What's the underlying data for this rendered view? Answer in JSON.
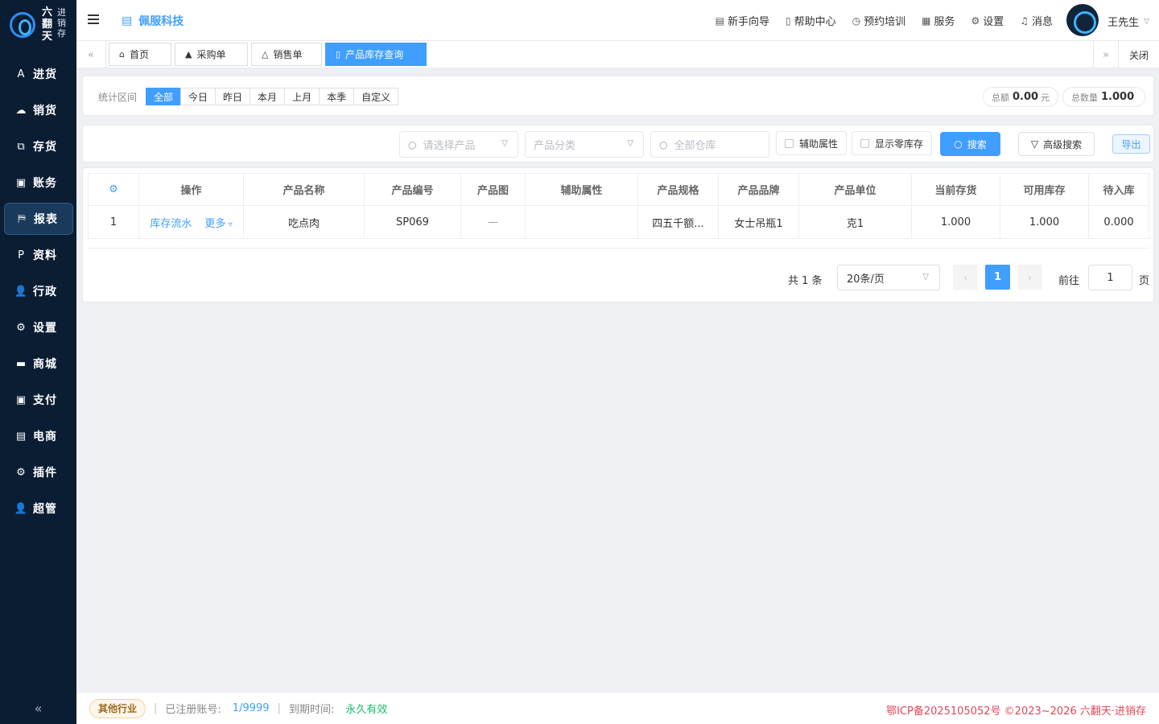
{
  "brand": {
    "big": "六翻天",
    "small": "进销存"
  },
  "sidebar": {
    "items": [
      {
        "label": "进货",
        "icon": "A"
      },
      {
        "label": "销货",
        "icon": "☁"
      },
      {
        "label": "存货",
        "icon": "⧉"
      },
      {
        "label": "账务",
        "icon": "▣"
      },
      {
        "label": "报表",
        "icon": "⛿",
        "active": true
      },
      {
        "label": "资料",
        "icon": "P"
      },
      {
        "label": "行政",
        "icon": "👤"
      },
      {
        "label": "设置",
        "icon": "⚙"
      },
      {
        "label": "商城",
        "icon": "▬"
      },
      {
        "label": "支付",
        "icon": "▣"
      },
      {
        "label": "电商",
        "icon": "▤"
      },
      {
        "label": "插件",
        "icon": "⚙"
      },
      {
        "label": "超管",
        "icon": "👤"
      }
    ],
    "collapse_icon": "«"
  },
  "header": {
    "company": "佩服科技",
    "links": [
      {
        "label": "新手向导",
        "icon": "▤"
      },
      {
        "label": "帮助中心",
        "icon": "▯"
      },
      {
        "label": "预约培训",
        "icon": "◷"
      },
      {
        "label": "服务",
        "icon": "▦"
      },
      {
        "label": "设置",
        "icon": "⚙"
      },
      {
        "label": "消息",
        "icon": "♫"
      }
    ],
    "user": "王先生"
  },
  "tabs": {
    "items": [
      {
        "label": "首页",
        "icon": "⌂"
      },
      {
        "label": "采购单",
        "icon": "▲"
      },
      {
        "label": "销售单",
        "icon": "△"
      },
      {
        "label": "产品库存查询",
        "icon": "▯",
        "active": true
      }
    ],
    "close_label": "关闭"
  },
  "period": {
    "label": "统计区间",
    "options": [
      "全部",
      "今日",
      "昨日",
      "本月",
      "上月",
      "本季",
      "自定义"
    ],
    "selected": "全部",
    "total_amount_label": "总额",
    "total_amount": "0.00",
    "total_amount_unit": "元",
    "total_qty_label": "总数量",
    "total_qty": "1.000"
  },
  "filter": {
    "product_placeholder": "请选择产品",
    "category_placeholder": "产品分类",
    "warehouse_placeholder": "全部仓库",
    "aux_label": "辅助属性",
    "zero_stock_label": "显示零库存",
    "search_label": "搜索",
    "advanced_label": "高级搜索",
    "export_label": "导出"
  },
  "table": {
    "headers": [
      "操作",
      "产品名称",
      "产品编号",
      "产品图",
      "辅助属性",
      "产品规格",
      "产品品牌",
      "产品单位",
      "当前存货",
      "可用库存",
      "待入库"
    ],
    "rows": [
      {
        "index": "1",
        "op_link": "库存流水",
        "op_more": "更多",
        "name": "吃点肉",
        "code": "SP069",
        "image": "—",
        "aux": "",
        "spec": "四五千额...",
        "brand": "女士吊瓶1",
        "unit": "克1",
        "current": "1.000",
        "available": "1.000",
        "pending": "0.000"
      }
    ]
  },
  "pager": {
    "total": "共 1 条",
    "page_size": "20条/页",
    "current": "1",
    "goto_label": "前往",
    "goto_value": "1",
    "page_label": "页"
  },
  "footer": {
    "industry": "其他行业",
    "registered_label": "已注册账号:",
    "registered_value": "1/9999",
    "expire_label": "到期时间:",
    "expire_value": "永久有效",
    "icp": "鄂ICP备2025105052号 ©2023~2026 六翻天·进销存"
  },
  "colors": {
    "sidebar_bg": "#0b1d33",
    "primary": "#409eff",
    "success": "#19be6b",
    "danger": "#e0475a"
  }
}
